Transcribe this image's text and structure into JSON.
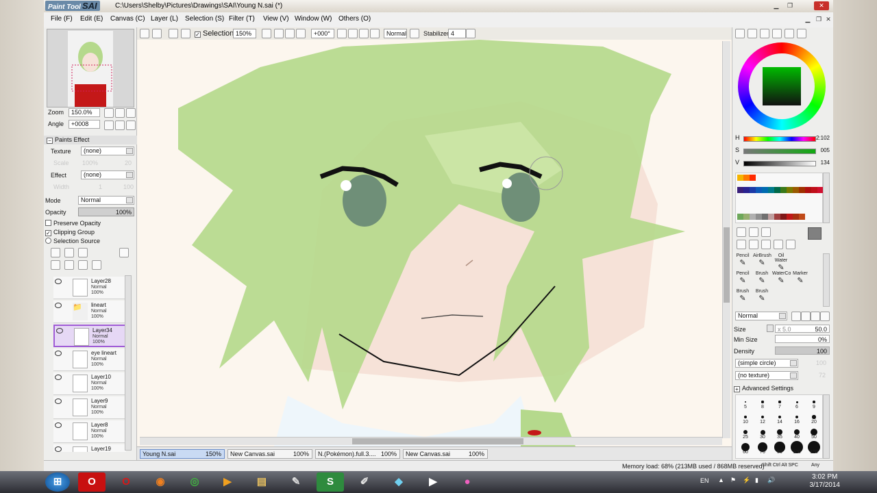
{
  "window": {
    "logo_small": "Paint Tool",
    "logo_big": "SAI",
    "title": "C:\\Users\\Shelby\\Pictures\\Drawings\\SAI\\Young N.sai (*)"
  },
  "menu": [
    "File (F)",
    "Edit (E)",
    "Canvas (C)",
    "Layer (L)",
    "Selection (S)",
    "Filter (T)",
    "View (V)",
    "Window (W)",
    "Others (O)"
  ],
  "toolbar": {
    "selection_label": "Selection",
    "zoom": "150%",
    "angle": "+000°",
    "mode": "Normal",
    "stabilizer_label": "Stabilizer",
    "stabilizer_value": "4"
  },
  "navigator": {
    "zoom_label": "Zoom",
    "zoom_value": "150.0%",
    "angle_label": "Angle",
    "angle_value": "+0008"
  },
  "paints_effect": {
    "header": "Paints Effect",
    "texture_label": "Texture",
    "texture_value": "(none)",
    "scale_label": "Scale",
    "scale_value": "100%",
    "scale_num": "20",
    "effect_label": "Effect",
    "effect_value": "(none)",
    "width_label": "Width",
    "width_value": "1",
    "width_num": "100"
  },
  "layer_props": {
    "mode_label": "Mode",
    "mode_value": "Normal",
    "opacity_label": "Opacity",
    "opacity_value": "100%",
    "preserve_opacity": "Preserve Opacity",
    "clipping_group": "Clipping Group",
    "selection_source": "Selection Source"
  },
  "layers": [
    {
      "name": "Layer28",
      "mode": "Normal",
      "opacity": "100%",
      "folder": false,
      "selected": false
    },
    {
      "name": "lineart",
      "mode": "Normal",
      "opacity": "100%",
      "folder": true,
      "selected": false
    },
    {
      "name": "Layer34",
      "mode": "Normal",
      "opacity": "100%",
      "folder": false,
      "selected": true
    },
    {
      "name": "eye lineart",
      "mode": "Normal",
      "opacity": "100%",
      "folder": false,
      "selected": false
    },
    {
      "name": "Layer10",
      "mode": "Normal",
      "opacity": "100%",
      "folder": false,
      "selected": false
    },
    {
      "name": "Layer9",
      "mode": "Normal",
      "opacity": "100%",
      "folder": false,
      "selected": false
    },
    {
      "name": "Layer8",
      "mode": "Normal",
      "opacity": "100%",
      "folder": false,
      "selected": false
    },
    {
      "name": "Layer19",
      "mode": "",
      "opacity": "",
      "folder": false,
      "selected": false
    }
  ],
  "color": {
    "h_label": "H",
    "h_value": "2:102",
    "s_label": "S",
    "s_value": "005",
    "v_label": "V",
    "v_value": "134",
    "swatches_row1": [
      "#f5b400",
      "#ff7a00",
      "#ff2a00"
    ],
    "swatches_row2": [
      "#3a1f7a",
      "#2a2290",
      "#1d3aa8",
      "#0e5ab8",
      "#006bb0",
      "#007a8a",
      "#006a4a",
      "#3a7a1a",
      "#7a7a00",
      "#9a5a00",
      "#a03000",
      "#b01010",
      "#c0101a",
      "#d01030"
    ],
    "swatches_row3": [
      "#6ea85a",
      "#98b070",
      "#b0b0b0",
      "#909090",
      "#707070",
      "#c0a0a0",
      "#a04040",
      "#801818",
      "#c01818",
      "#a83010",
      "#c04a18"
    ]
  },
  "tools": [
    {
      "name": "Pencil",
      "sub": ""
    },
    {
      "name": "AirBrush",
      "sub": ""
    },
    {
      "name": "Oil Water",
      "sub": ""
    },
    {
      "name": "Pencil",
      "sub": ""
    },
    {
      "name": "Brush",
      "sub": ""
    },
    {
      "name": "WaterCo",
      "sub": ""
    },
    {
      "name": "Marker",
      "sub": ""
    },
    {
      "name": "Brush",
      "sub": ""
    },
    {
      "name": "Brush",
      "sub": ""
    }
  ],
  "brush": {
    "blend_mode": "Normal",
    "size_label": "Size",
    "size_mult": "x 5.0",
    "size_value": "50.0",
    "min_size_label": "Min Size",
    "min_size_value": "0%",
    "density_label": "Density",
    "density_value": "100",
    "shape": "(simple circle)",
    "shape_num": "100",
    "texture": "(no texture)",
    "texture_num": "72",
    "advanced": "Advanced Settings",
    "dot_sizes": [
      "5",
      "8",
      "7",
      "6",
      "9",
      "10",
      "12",
      "14",
      "16",
      "20",
      "25",
      "30",
      "35",
      "40",
      "50",
      "60",
      "70",
      "80",
      "100",
      "120"
    ]
  },
  "tabs": [
    {
      "name": "Young N.sai",
      "pct": "150%",
      "active": true
    },
    {
      "name": "New Canvas.sai",
      "pct": "100%",
      "active": false
    },
    {
      "name": "N.(Pokémon).full.3....",
      "pct": "100%",
      "active": false
    },
    {
      "name": "New Canvas.sai",
      "pct": "100%",
      "active": false
    }
  ],
  "status": {
    "memory": "Memory load: 68% (213MB used / 868MB reserved)",
    "keys": "Shift Ctrl Alt SPC",
    "any": "Any"
  },
  "taskbar": {
    "lang": "EN",
    "time": "3:02 PM",
    "date": "3/17/2014"
  },
  "colors": {
    "accent_select": "#a05cd6",
    "hair": "#b5d98c",
    "skin": "#f6e2d8"
  }
}
